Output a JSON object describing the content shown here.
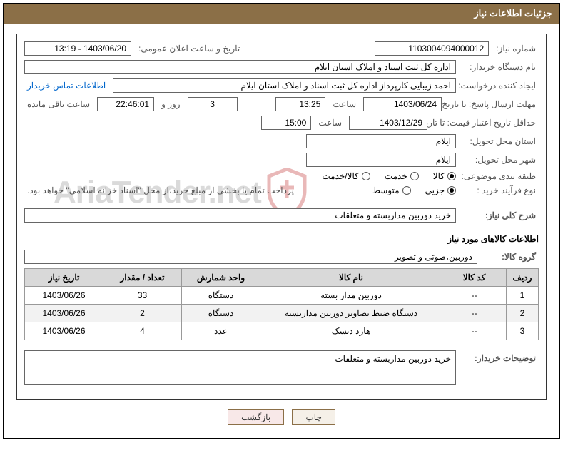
{
  "title_bar": "جزئیات اطلاعات نیاز",
  "labels": {
    "need_no": "شماره نیاز:",
    "announce_datetime": "تاریخ و ساعت اعلان عمومی:",
    "buyer": "نام دستگاه خریدار:",
    "requester": "ایجاد کننده درخواست:",
    "contact_link": "اطلاعات تماس خریدار",
    "reply_deadline": "مهلت ارسال پاسخ: تا تاریخ:",
    "time": "ساعت",
    "days_and": "روز و",
    "remaining": "ساعت باقی مانده",
    "price_valid_min": "حداقل تاریخ اعتبار قیمت: تا تاریخ:",
    "delivery_province": "استان محل تحویل:",
    "delivery_city": "شهر محل تحویل:",
    "category": "طبقه بندی موضوعی:",
    "purchase_type": "نوع فرآیند خرید :",
    "purchase_note": "پرداخت تمام یا بخشی از مبلغ خرید،از محل \"اسناد خزانه اسلامی\" خواهد بود.",
    "summary": "شرح کلی نیاز:",
    "goods_info_header": "اطلاعات کالاهای مورد نیاز",
    "goods_group": "گروه کالا:",
    "buyer_notes": "توضیحات خریدار:"
  },
  "values": {
    "need_no": "1103004094000012",
    "announce_datetime": "1403/06/20 - 13:19",
    "buyer": "اداره کل ثبت اسناد و املاک استان ایلام",
    "requester": "احمد زیبایی کارپرداز اداره کل ثبت اسناد و املاک استان ایلام",
    "reply_date": "1403/06/24",
    "reply_time": "13:25",
    "remaining_days": "3",
    "remaining_hms": "22:46:01",
    "price_valid_date": "1403/12/29",
    "price_valid_time": "15:00",
    "province": "ایلام",
    "city": "ایلام",
    "summary": "خرید دوربین مداربسته و متعلقات",
    "goods_group": "دوربین،صوتی و تصویر",
    "buyer_notes": "خرید دوربین مداربسته و متعلقات"
  },
  "category": {
    "options": [
      "کالا",
      "خدمت",
      "کالا/خدمت"
    ],
    "selected": 0
  },
  "purchase_type": {
    "options": [
      "جزیی",
      "متوسط"
    ],
    "selected": 0
  },
  "table": {
    "headers": [
      "ردیف",
      "کد کالا",
      "نام کالا",
      "واحد شمارش",
      "تعداد / مقدار",
      "تاریخ نیاز"
    ],
    "rows": [
      {
        "idx": "1",
        "code": "--",
        "name": "دوربین مدار بسته",
        "unit": "دستگاه",
        "qty": "33",
        "date": "1403/06/26"
      },
      {
        "idx": "2",
        "code": "--",
        "name": "دستگاه ضبط تصاویر دوربین مداربسته",
        "unit": "دستگاه",
        "qty": "2",
        "date": "1403/06/26"
      },
      {
        "idx": "3",
        "code": "--",
        "name": "هارد دیسک",
        "unit": "عدد",
        "qty": "4",
        "date": "1403/06/26"
      }
    ]
  },
  "buttons": {
    "print": "چاپ",
    "back": "بازگشت"
  },
  "watermark": "AriaTender.net"
}
